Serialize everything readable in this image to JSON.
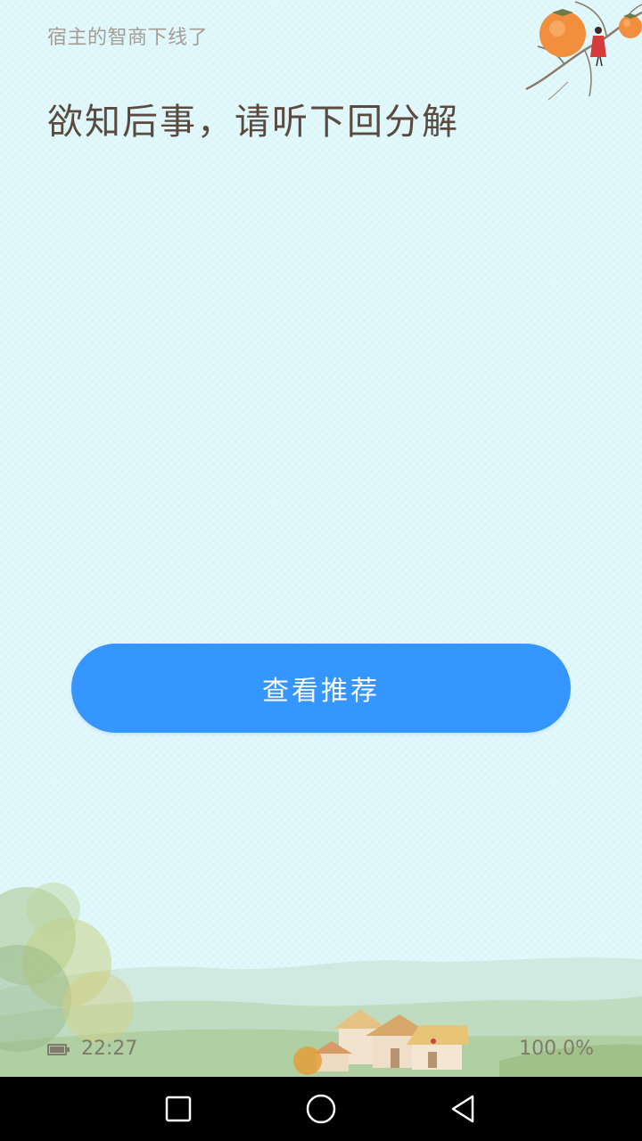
{
  "reader": {
    "subtitle": "宿主的智商下线了",
    "chapter_title": "欲知后事，请听下回分解",
    "action_button_label": "查看推荐"
  },
  "status_footer": {
    "time": "22:27",
    "progress": "100.0%",
    "battery_icon": "battery-icon"
  },
  "nav_bar": {
    "recent_icon": "square-icon",
    "home_icon": "circle-icon",
    "back_icon": "triangle-back-icon"
  },
  "colors": {
    "background": "#dff8fb",
    "button": "#3696ff",
    "button_text": "#ffffff",
    "title_text": "#5b4a3f",
    "subtitle_text": "#a59c94",
    "footer_text": "#7f7a6c",
    "nav_bar": "#000000"
  }
}
